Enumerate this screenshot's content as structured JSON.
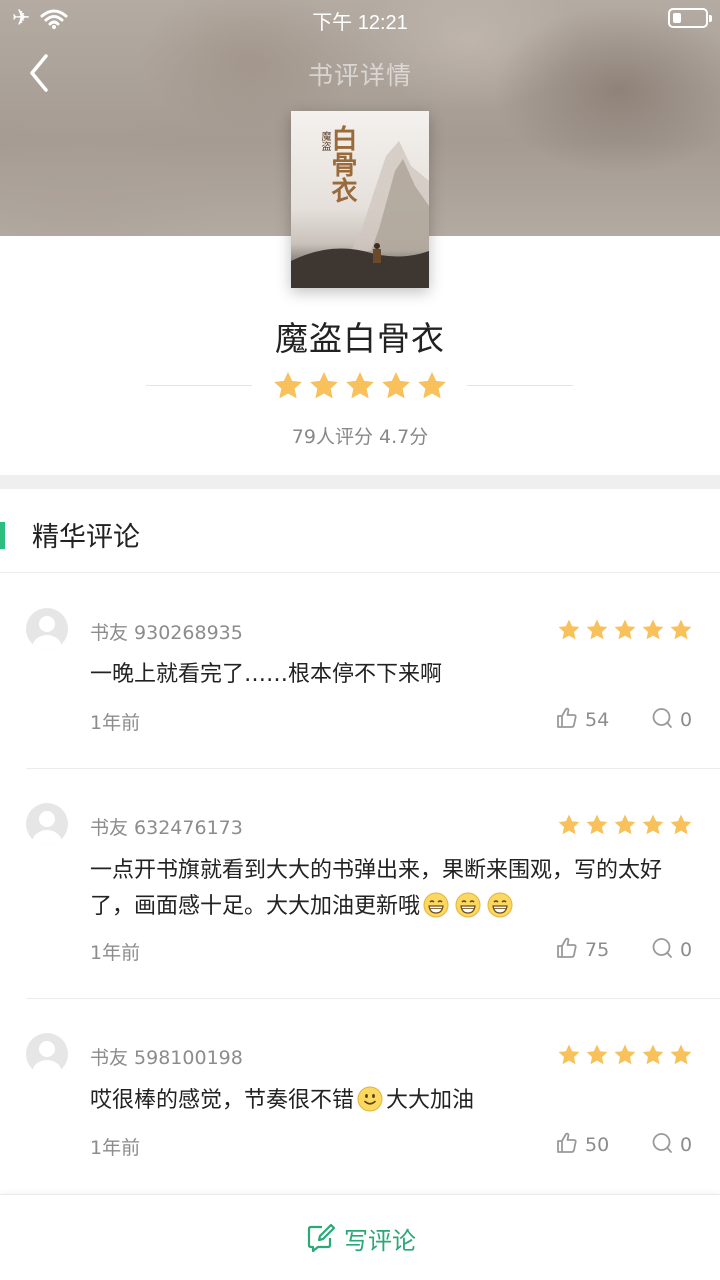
{
  "status_bar": {
    "time": "下午 12:21"
  },
  "header": {
    "title": "书评详情"
  },
  "book": {
    "title": "魔盗白骨衣",
    "cover_small_text": "魔盗",
    "cover_big_text": "白骨衣",
    "rating_summary": "79人评分 4.7分",
    "stars": 5
  },
  "section": {
    "title": "精华评论"
  },
  "reviews": [
    {
      "user": "书友 930268935",
      "text": "一晚上就看完了……根本停不下来啊",
      "time": "1年前",
      "likes": "54",
      "comments": "0",
      "stars": 5
    },
    {
      "user": "书友 632476173",
      "text": "一点开书旗就看到大大的书弹出来，果断来围观，写的太好了，画面感十足。大大加油更新哦",
      "time": "1年前",
      "likes": "75",
      "comments": "0",
      "stars": 5,
      "emoji": "grin-emoji"
    },
    {
      "user": "书友 598100198",
      "text_before": "哎很棒的感觉，节奏很不错",
      "text_after": "大大加油",
      "time": "1年前",
      "likes": "50",
      "comments": "0",
      "stars": 5,
      "emoji": "smile-emoji"
    }
  ],
  "bottom_bar": {
    "write_label": "写评论"
  },
  "colors": {
    "accent": "#2dbd7e",
    "star": "#f8c15c",
    "write": "#2aa876"
  }
}
